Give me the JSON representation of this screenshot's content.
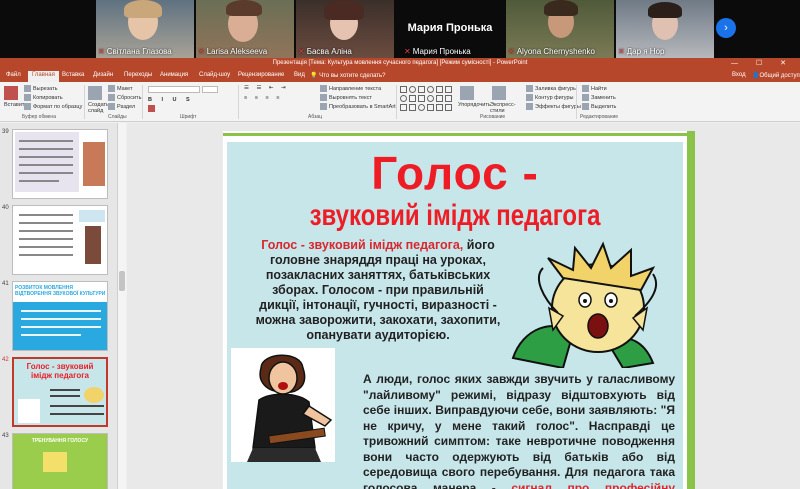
{
  "participants": [
    {
      "name": "Світлана Глазова",
      "muted": true
    },
    {
      "name": "Larisa Alekseeva",
      "muted": true
    },
    {
      "name": "Басва Аліна",
      "muted": true
    },
    {
      "name": "Мария Пронька",
      "muted": true,
      "display_name": "Мария Пронька"
    },
    {
      "name": "Alyona Chernyshenko",
      "muted": true
    },
    {
      "name": "Дар я Нор",
      "muted": true
    }
  ],
  "window_title": "Презентація [Тема: Культура мовлення сучасного педагога] [Режим сумісності] - PowerPoint",
  "window_controls": "— ☐ ✕",
  "tabs": [
    "Файл",
    "Главная",
    "Вставка",
    "Дизайн",
    "Переходы",
    "Анимация",
    "Слайд-шоу",
    "Рецензирование",
    "Вид",
    "Что вы хотите сделать?"
  ],
  "tabs_right": {
    "login": "Вход",
    "share": "Общий доступ"
  },
  "ribbon": {
    "paste": "Вставить",
    "cut": "Вырезать",
    "copy": "Копировать",
    "format_painter": "Формат по образцу",
    "clipboard_group": "Буфер обмена",
    "new_slide": "Создать слайд",
    "layout": "Макет",
    "reset": "Сбросить",
    "section": "Раздел",
    "slides_group": "Слайды",
    "font_group": "Шрифт",
    "text_direction": "Направление текста",
    "align_text": "Выровнять текст",
    "smartart": "Преобразовать в SmartArt",
    "paragraph_group": "Абзац",
    "arrange": "Упорядочить",
    "quick_styles": "Экспресс-стили",
    "drawing_group": "Рисование",
    "shape_fill": "Заливка фигуры",
    "shape_outline": "Контур фигуры",
    "shape_effects": "Эффекты фигуры",
    "find": "Найти",
    "replace": "Заменить",
    "select": "Выделить",
    "editing_group": "Редактирование"
  },
  "slides": [
    {
      "num": "39"
    },
    {
      "num": "40"
    },
    {
      "num": "41",
      "title": "РОЗВИТОК МОВЛЕННЯ ВІДТВОРЕННЯ ЗВУКОВОЇ КУЛЬТУРИ"
    },
    {
      "num": "42",
      "title": "Голос - звуковий імідж педагога"
    },
    {
      "num": "43",
      "title": "ТРЕНУВАННЯ ГОЛОСУ"
    }
  ],
  "current_slide": {
    "title_line1": "Голос -",
    "title_line2": "звуковий імідж педагога",
    "para1_highlight": "Голос - звуковий імідж педагога,",
    "para1_rest": "його головне знаряддя праці на уроках, позакласних заняттях, батьківських зборах. Голосом - при правильній дикції, інтонації, гучності, виразності - можна заворожити, закохати, захопити, опанувати аудиторією.",
    "para2_main": "А люди, голос яких завжди звучить у галасливому \"лайливому\" режимі, відразу відштовхують від себе інших. Виправдуючи себе, вони заявляють: \"Я не кричу, у мене такий голос\". Насправді це тривожний симптом: таке невротичне поводження вони часто одержують від батьків або від середовища свого перебування. Для педагога така голосова манера -",
    "para2_highlight": "сигнал про професійну непридатність."
  },
  "colors": {
    "ppt_accent": "#b7472a",
    "title_red": "#ee1c25",
    "slide_bg": "#c7e6ea",
    "green_frame": "#8bc34a"
  }
}
